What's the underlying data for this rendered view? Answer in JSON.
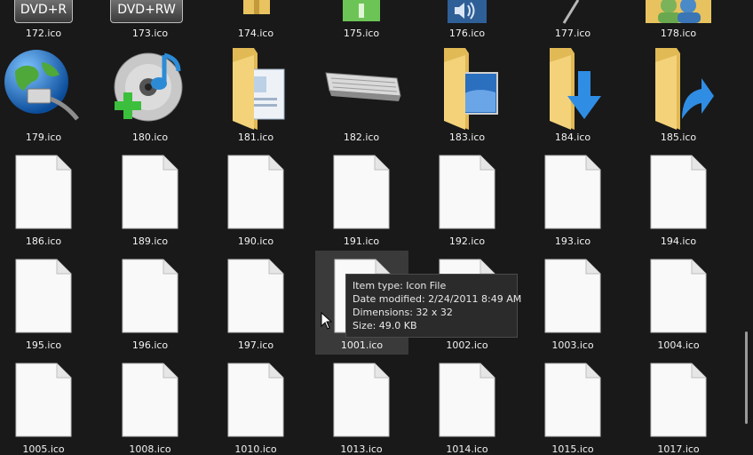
{
  "rows": [
    [
      "172.ico",
      "173.ico",
      "174.ico",
      "175.ico",
      "176.ico",
      "177.ico",
      "178.ico"
    ],
    [
      "179.ico",
      "180.ico",
      "181.ico",
      "182.ico",
      "183.ico",
      "184.ico",
      "185.ico"
    ],
    [
      "186.ico",
      "189.ico",
      "190.ico",
      "191.ico",
      "192.ico",
      "193.ico",
      "194.ico"
    ],
    [
      "195.ico",
      "196.ico",
      "197.ico",
      "1001.ico",
      "1002.ico",
      "1003.ico",
      "1004.ico"
    ],
    [
      "1005.ico",
      "1008.ico",
      "1010.ico",
      "1013.ico",
      "1014.ico",
      "1015.ico",
      "1017.ico"
    ]
  ],
  "dvd_labels": {
    "first": "DVD+R",
    "second": "DVD+RW"
  },
  "tooltip": {
    "item_type": "Item type: Icon File",
    "date_modified": "Date modified: 2/24/2011 8:49 AM",
    "dimensions": "Dimensions: 32 x 32",
    "size": "Size: 49.0 KB"
  },
  "icons": {
    "row1": [
      "dvd-r-icon",
      "dvd-rw-icon",
      "zipped-folder-icon",
      "green-drive-icon",
      "speaker-icon",
      "pen-icon",
      "users-icon"
    ],
    "row2": [
      "network-globe-icon",
      "music-disc-add-icon",
      "contacts-folder-icon",
      "keyboard-icon",
      "desktop-folder-icon",
      "downloads-folder-icon",
      "shortcut-folder-icon"
    ]
  },
  "colors": {
    "background": "#191919",
    "hover": "#3a3a3a",
    "folder": "#f3d27a"
  }
}
